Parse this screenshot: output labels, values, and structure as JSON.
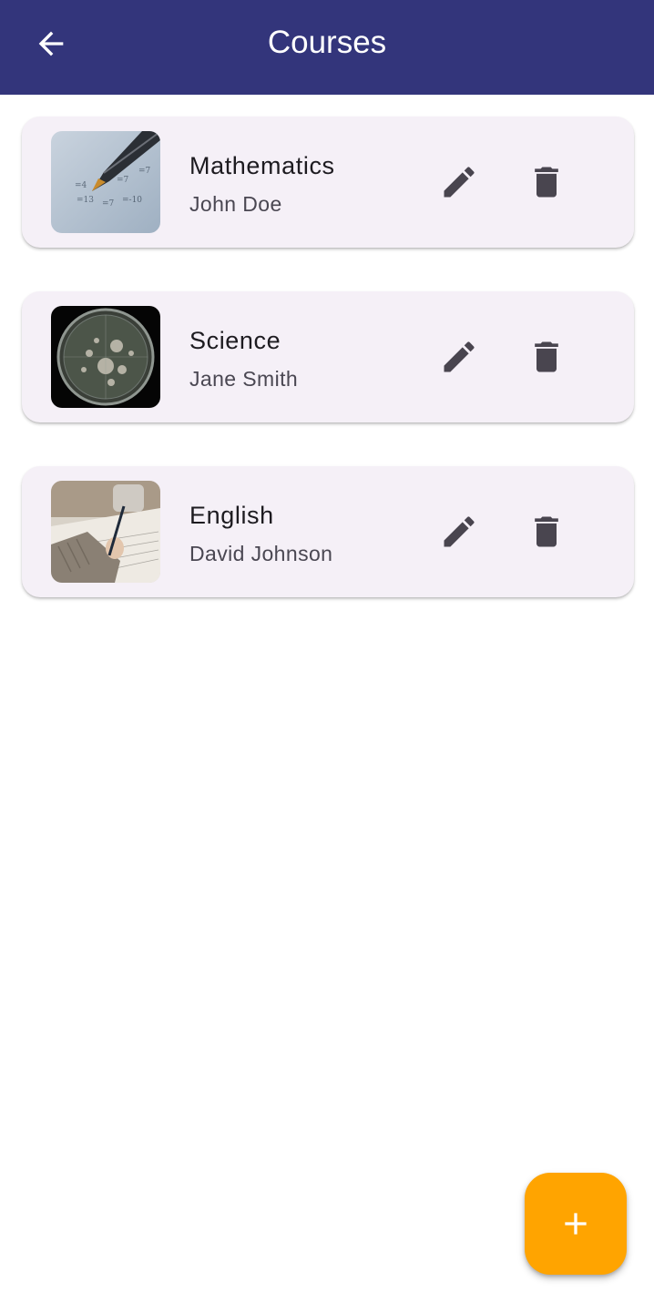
{
  "app_bar": {
    "title": "Courses",
    "background": "#33357b",
    "back_icon": "arrow-back-icon"
  },
  "courses": [
    {
      "name": "Mathematics",
      "teacher": "John Doe",
      "image": "pencil-on-math-paper"
    },
    {
      "name": "Science",
      "teacher": "Jane Smith",
      "image": "petri-dish"
    },
    {
      "name": "English",
      "teacher": "David Johnson",
      "image": "hand-writing-with-pen"
    }
  ],
  "actions": {
    "edit_icon": "edit-icon",
    "delete_icon": "delete-icon"
  },
  "fab": {
    "icon": "add-icon",
    "color": "#ffa400"
  },
  "colors": {
    "card_background": "#f5f0f7",
    "icon_color": "#49454f"
  }
}
